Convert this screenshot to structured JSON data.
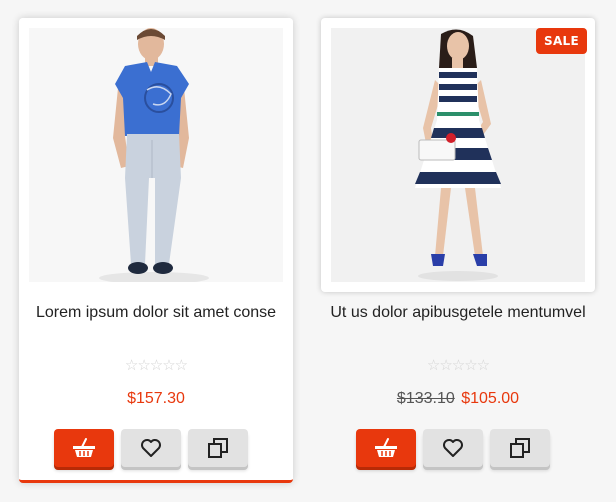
{
  "products": [
    {
      "title": "Lorem ipsum dolor sit amet conse",
      "price": "$157.30",
      "old_price": "",
      "rating": 0,
      "badge": "",
      "highlighted": true,
      "icons": {
        "cart": "basket-icon",
        "wishlist": "heart-icon",
        "compare": "compare-icon"
      }
    },
    {
      "title": "Ut us dolor apibusgetele mentumvel",
      "price": "$105.00",
      "old_price": "$133.10",
      "rating": 0,
      "badge": "SALE",
      "highlighted": false,
      "icons": {
        "cart": "basket-icon",
        "wishlist": "heart-icon",
        "compare": "compare-icon"
      }
    }
  ],
  "colors": {
    "accent": "#e8380d",
    "button_gray": "#e2e2e2",
    "star_empty": "#d4d4d4",
    "text": "#222222"
  }
}
